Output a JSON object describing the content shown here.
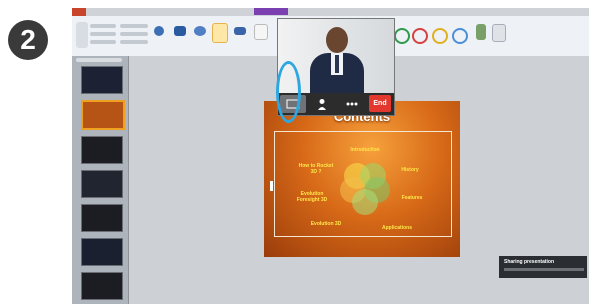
{
  "step": {
    "number": "2"
  },
  "slide": {
    "title": "Contents",
    "topics": [
      "Introduction",
      "History",
      "How to Rocket 3D ?",
      "Evolution Foresight 3D",
      "Features",
      "Evolution 3D",
      "Applications"
    ]
  },
  "video_controls": {
    "end_label": "End"
  },
  "icons": [
    "presenter-icon",
    "more-icon"
  ],
  "toast": {
    "title": "Sharing presentation"
  },
  "colors": {
    "highlight": "#2ea7e0",
    "end_button": "#e2382d",
    "slide_orange": "#d86a18"
  }
}
